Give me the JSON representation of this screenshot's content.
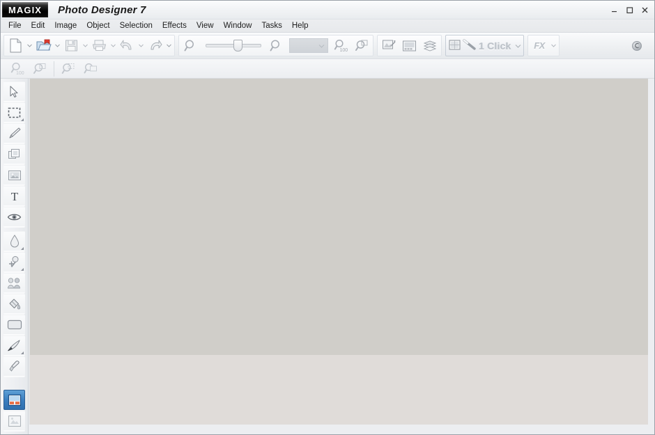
{
  "window": {
    "brand": "MAGIX",
    "title": "Photo Designer 7",
    "controls": [
      {
        "name": "minimize-button",
        "label": "–"
      },
      {
        "name": "maximize-button",
        "label": "□"
      },
      {
        "name": "close-button",
        "label": "✕"
      }
    ]
  },
  "menubar": {
    "items": [
      {
        "label": "File"
      },
      {
        "label": "Edit"
      },
      {
        "label": "Image"
      },
      {
        "label": "Object"
      },
      {
        "label": "Selection"
      },
      {
        "label": "Effects"
      },
      {
        "label": "View"
      },
      {
        "label": "Window"
      },
      {
        "label": "Tasks"
      },
      {
        "label": "Help"
      }
    ]
  },
  "toolbar_main": {
    "file_group": [
      {
        "name": "new-button",
        "icon": "new-document-icon",
        "enabled": true,
        "has_dropdown": true
      },
      {
        "name": "open-button",
        "icon": "open-folder-icon",
        "enabled": true,
        "has_dropdown": true
      },
      {
        "name": "save-button",
        "icon": "floppy-disk-icon",
        "enabled": false,
        "has_dropdown": true
      },
      {
        "name": "print-button",
        "icon": "printer-icon",
        "enabled": false,
        "has_dropdown": true
      },
      {
        "name": "undo-button",
        "icon": "undo-arrow-icon",
        "enabled": false,
        "has_dropdown": true
      },
      {
        "name": "redo-button",
        "icon": "redo-arrow-icon",
        "enabled": false,
        "has_dropdown": true
      }
    ],
    "zoom_group": {
      "zoom_out": {
        "name": "zoom-out-button",
        "icon": "magnifier-minus-icon"
      },
      "slider": {
        "name": "zoom-slider",
        "value": 50,
        "min": 0,
        "max": 100
      },
      "zoom_in": {
        "name": "zoom-in-button",
        "icon": "magnifier-plus-icon"
      },
      "level_combo": {
        "name": "zoom-level-combo",
        "value": "",
        "placeholder": ""
      },
      "zoom_100": {
        "name": "zoom-100-button",
        "icon": "magnifier-100-icon",
        "label": "100"
      },
      "zoom_fit": {
        "name": "zoom-fit-button",
        "icon": "magnifier-fit-icon"
      }
    },
    "view_group": [
      {
        "name": "photo-effects-button",
        "icon": "photo-hand-icon"
      },
      {
        "name": "print-layout-button",
        "icon": "filmstrip-icon"
      },
      {
        "name": "layers-button",
        "icon": "layers-stack-icon"
      }
    ],
    "oneclick": {
      "name": "one-click-button",
      "label": "1 Click",
      "image_icon": "image-thumbnail-icon",
      "wand_icon": "magic-wand-icon",
      "has_dropdown": true
    },
    "fx": {
      "name": "fx-button",
      "label": "FX",
      "has_dropdown": true
    },
    "help": {
      "name": "help-button",
      "icon": "help-circle-icon"
    }
  },
  "toolbar_zoom": {
    "items": [
      {
        "name": "zoom-actual-size-button",
        "icon": "magnifier-100-icon",
        "enabled": false
      },
      {
        "name": "zoom-fit-page-button",
        "icon": "magnifier-page-icon",
        "enabled": false
      },
      {
        "name": "zoom-selection-button",
        "icon": "magnifier-selection-icon",
        "enabled": false
      },
      {
        "name": "zoom-object-button",
        "icon": "magnifier-object-icon",
        "enabled": false
      }
    ]
  },
  "tools": {
    "items": [
      {
        "name": "tool-select-arrow",
        "icon": "arrow-pointer-icon",
        "active": false,
        "has_flyout": false
      },
      {
        "name": "tool-marquee-selection",
        "icon": "dashed-rectangle-icon",
        "active": false,
        "has_flyout": true
      },
      {
        "name": "tool-line",
        "icon": "pencil-line-icon",
        "active": false,
        "has_flyout": false
      },
      {
        "name": "tool-clone-object",
        "icon": "stacked-frames-icon",
        "active": false,
        "has_flyout": false
      },
      {
        "name": "tool-crop-image",
        "icon": "picture-frame-icon",
        "active": false,
        "has_flyout": false
      },
      {
        "name": "tool-text",
        "icon": "text-t-icon",
        "active": false,
        "has_flyout": false
      },
      {
        "name": "tool-red-eye",
        "icon": "eye-icon",
        "active": false,
        "has_flyout": false
      },
      {
        "name": "tool-blur-droplet",
        "icon": "droplet-icon",
        "active": false,
        "has_flyout": true
      },
      {
        "name": "tool-dodge-burn",
        "icon": "dodge-burn-icon",
        "active": false,
        "has_flyout": true
      },
      {
        "name": "tool-clone-stamp",
        "icon": "clone-stamp-icon",
        "active": false,
        "has_flyout": false
      },
      {
        "name": "tool-paint-bucket",
        "icon": "paint-bucket-icon",
        "active": false,
        "has_flyout": false
      },
      {
        "name": "tool-shape-rectangle",
        "icon": "rounded-rectangle-icon",
        "active": false,
        "has_flyout": false
      },
      {
        "name": "tool-brush",
        "icon": "paintbrush-icon",
        "active": false,
        "has_flyout": true
      },
      {
        "name": "tool-eyedropper",
        "icon": "eyedropper-icon",
        "active": false,
        "has_flyout": false
      }
    ],
    "panel_toggles": [
      {
        "name": "tool-media-pool-toggle",
        "icon": "media-pool-icon",
        "active": true
      },
      {
        "name": "tool-photo-browser-toggle",
        "icon": "photo-browser-icon",
        "active": false
      }
    ]
  },
  "workspace": {
    "name": "document-canvas-area",
    "upper_color": "#d0cec9",
    "lower_color": "#e0dcd9",
    "empty": true
  }
}
